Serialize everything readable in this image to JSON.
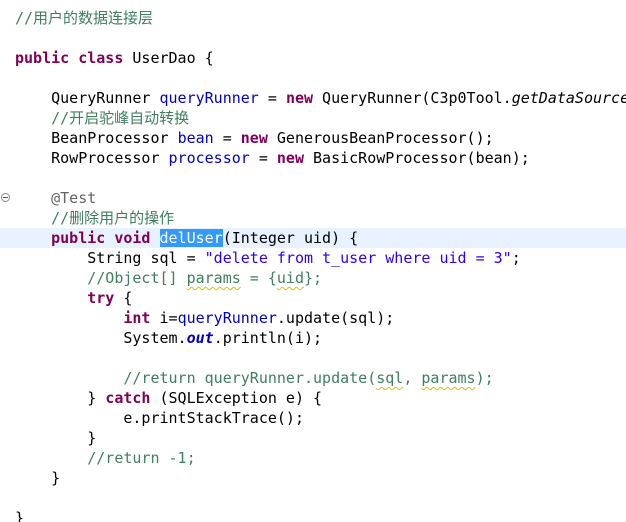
{
  "editor": {
    "lines": [
      {
        "segments": [
          {
            "t": "//用户的数据连接层",
            "c": "cm"
          }
        ]
      },
      {
        "segments": []
      },
      {
        "segments": [
          {
            "t": "public",
            "c": "kw"
          },
          {
            "t": " "
          },
          {
            "t": "class",
            "c": "kw"
          },
          {
            "t": " UserDao {"
          }
        ]
      },
      {
        "segments": []
      },
      {
        "segments": [
          {
            "t": "    QueryRunner "
          },
          {
            "t": "queryRunner",
            "c": "fld"
          },
          {
            "t": " = "
          },
          {
            "t": "new",
            "c": "kw"
          },
          {
            "t": " QueryRunner(C3p0Tool."
          },
          {
            "t": "getDataSource",
            "c": "italic"
          }
        ]
      },
      {
        "segments": [
          {
            "t": "    "
          },
          {
            "t": "//开启驼峰自动转换",
            "c": "cm"
          }
        ]
      },
      {
        "segments": [
          {
            "t": "    BeanProcessor "
          },
          {
            "t": "bean",
            "c": "fld"
          },
          {
            "t": " = "
          },
          {
            "t": "new",
            "c": "kw"
          },
          {
            "t": " GenerousBeanProcessor();"
          }
        ]
      },
      {
        "segments": [
          {
            "t": "    RowProcessor "
          },
          {
            "t": "processor",
            "c": "fld"
          },
          {
            "t": " = "
          },
          {
            "t": "new",
            "c": "kw"
          },
          {
            "t": " BasicRowProcessor(bean);"
          }
        ]
      },
      {
        "segments": []
      },
      {
        "segments": [
          {
            "t": "    "
          },
          {
            "t": "@Test",
            "c": "ann"
          }
        ]
      },
      {
        "segments": [
          {
            "t": "    "
          },
          {
            "t": "//删除用户的操作",
            "c": "cm"
          }
        ]
      },
      {
        "segments": [
          {
            "t": "    "
          },
          {
            "t": "public",
            "c": "kw"
          },
          {
            "t": " "
          },
          {
            "t": "void",
            "c": "kw"
          },
          {
            "t": " "
          },
          {
            "t": "delUser",
            "c": "sel"
          },
          {
            "t": "(Integer uid) {"
          }
        ],
        "current": true
      },
      {
        "segments": [
          {
            "t": "        String sql = "
          },
          {
            "t": "\"delete from t_user where uid = 3\"",
            "c": "str"
          },
          {
            "t": ";"
          }
        ]
      },
      {
        "segments": [
          {
            "t": "        "
          },
          {
            "t": "//Object[] ",
            "c": "cm"
          },
          {
            "t": "params",
            "c": "cm sq"
          },
          {
            "t": " = {",
            "c": "cm"
          },
          {
            "t": "uid",
            "c": "cm sq"
          },
          {
            "t": "};",
            "c": "cm"
          }
        ]
      },
      {
        "segments": [
          {
            "t": "        "
          },
          {
            "t": "try",
            "c": "kw"
          },
          {
            "t": " {"
          }
        ]
      },
      {
        "segments": [
          {
            "t": "            "
          },
          {
            "t": "int",
            "c": "kw"
          },
          {
            "t": " i="
          },
          {
            "t": "queryRunner",
            "c": "fld"
          },
          {
            "t": ".update(sql);"
          }
        ]
      },
      {
        "segments": [
          {
            "t": "            System."
          },
          {
            "t": "out",
            "c": "static"
          },
          {
            "t": ".println(i);"
          }
        ]
      },
      {
        "segments": []
      },
      {
        "segments": [
          {
            "t": "            "
          },
          {
            "t": "//return queryRunner.update(",
            "c": "cm"
          },
          {
            "t": "sql",
            "c": "cm sq"
          },
          {
            "t": ", ",
            "c": "cm"
          },
          {
            "t": "params",
            "c": "cm sq"
          },
          {
            "t": ");",
            "c": "cm"
          }
        ]
      },
      {
        "segments": [
          {
            "t": "        } "
          },
          {
            "t": "catch",
            "c": "kw"
          },
          {
            "t": " (SQLException e) {"
          }
        ]
      },
      {
        "segments": [
          {
            "t": "            e.printStackTrace();"
          }
        ]
      },
      {
        "segments": [
          {
            "t": "        }"
          }
        ]
      },
      {
        "segments": [
          {
            "t": "        "
          },
          {
            "t": "//return -1;",
            "c": "cm"
          }
        ]
      },
      {
        "segments": [
          {
            "t": "    }"
          }
        ]
      },
      {
        "segments": []
      },
      {
        "segments": [
          {
            "t": "}"
          }
        ]
      }
    ]
  }
}
